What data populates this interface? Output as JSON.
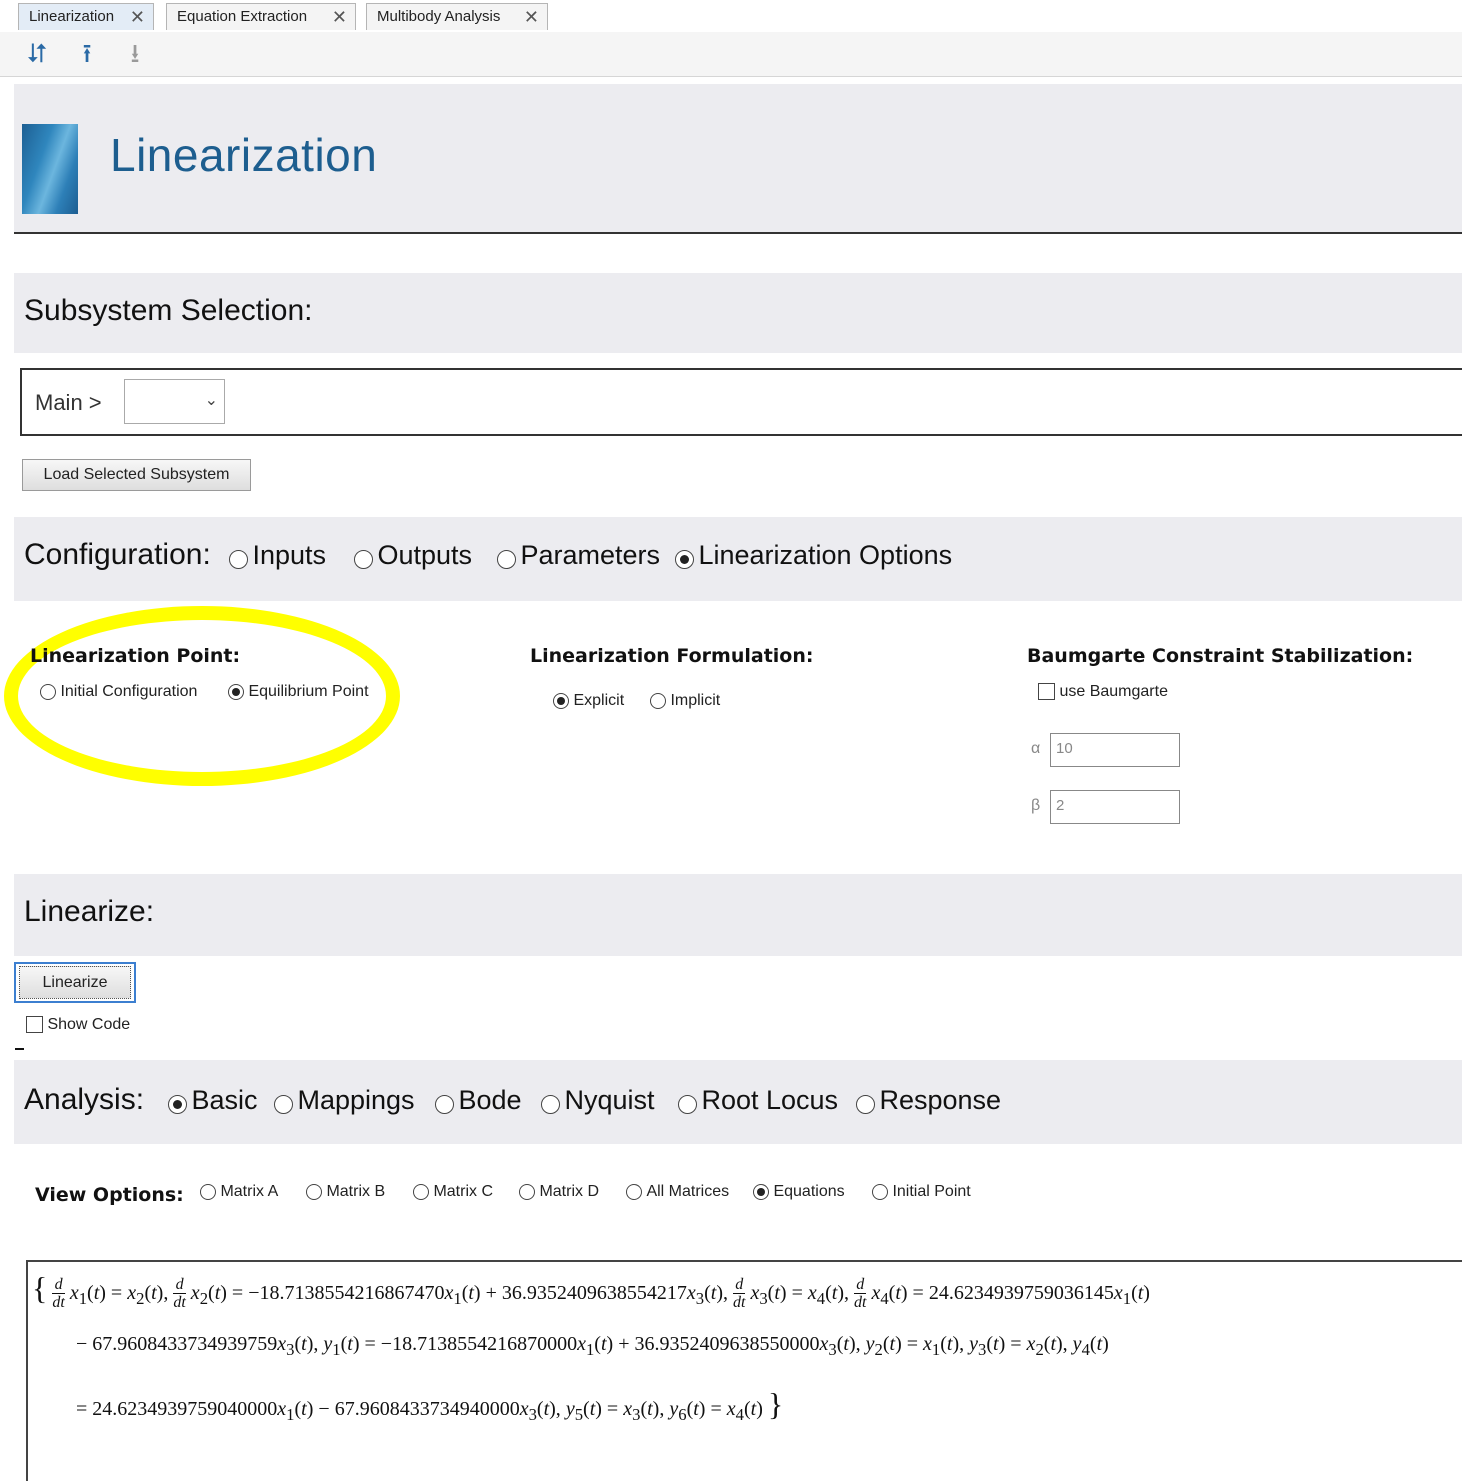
{
  "tabs": [
    {
      "label": "Linearization",
      "active": true
    },
    {
      "label": "Equation Extraction",
      "active": false
    },
    {
      "label": "Multibody Analysis",
      "active": false
    }
  ],
  "toolbar": {
    "icons": [
      "swap-arrows-icon",
      "upload-arrow-icon",
      "download-arrow-icon"
    ]
  },
  "header": {
    "title": "Linearization"
  },
  "subsystem": {
    "section_title": "Subsystem Selection:",
    "breadcrumb": "Main >",
    "select_value": "",
    "load_button": "Load Selected Subsystem"
  },
  "configuration": {
    "section_title": "Configuration:",
    "options": [
      "Inputs",
      "Outputs",
      "Parameters",
      "Linearization Options"
    ],
    "selected": "Linearization Options"
  },
  "linearization_point": {
    "heading": "Linearization Point:",
    "options": [
      "Initial Configuration",
      "Equilibrium Point"
    ],
    "selected": "Equilibrium Point"
  },
  "formulation": {
    "heading": "Linearization Formulation:",
    "options": [
      "Explicit",
      "Implicit"
    ],
    "selected": "Explicit"
  },
  "baumgarte": {
    "heading": "Baumgarte Constraint Stabilization:",
    "checkbox_label": "use Baumgarte",
    "checked": false,
    "alpha_label": "α",
    "alpha_value": "10",
    "beta_label": "β",
    "beta_value": "2"
  },
  "linearize": {
    "section_title": "Linearize:",
    "button": "Linearize",
    "show_code_label": "Show Code",
    "show_code_checked": false
  },
  "analysis": {
    "section_title": "Analysis:",
    "options": [
      "Basic",
      "Mappings",
      "Bode",
      "Nyquist",
      "Root Locus",
      "Response"
    ],
    "selected": "Basic"
  },
  "view_options": {
    "label": "View Options:",
    "options": [
      "Matrix A",
      "Matrix B",
      "Matrix C",
      "Matrix D",
      "All Matrices",
      "Equations",
      "Initial Point"
    ],
    "selected": "Equations"
  },
  "equations": {
    "c1": "18.7138554216867470",
    "c2": "36.9352409638554217",
    "c3": "24.6234939759036145",
    "c4": "67.9608433734939759",
    "c5": "18.7138554216870000",
    "c6": "36.9352409638550000",
    "c7": "24.6234939759040000",
    "c8": "67.9608433734940000"
  },
  "colors": {
    "accent": "#1d5e8f",
    "band": "#ececf0",
    "highlight": "#ffff00"
  }
}
